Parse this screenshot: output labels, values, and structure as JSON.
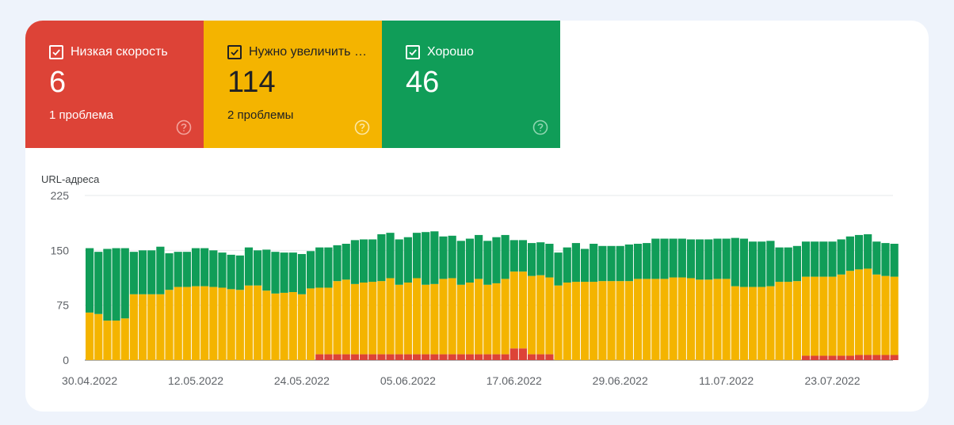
{
  "tiles": [
    {
      "title": "Низкая скорость",
      "value": "6",
      "sub": "1 проблема",
      "color": "#dd4337"
    },
    {
      "title": "Нужно увеличить скорость",
      "value": "114",
      "sub": "2 проблемы",
      "color": "#f4b400"
    },
    {
      "title": "Хорошо",
      "value": "46",
      "sub": "",
      "color": "#109d58"
    }
  ],
  "icons": {
    "checkbox": "checkbox-checked-icon",
    "help": "help-circle-icon"
  },
  "chart_data": {
    "type": "bar",
    "stacked": true,
    "ylabel": "URL-адреса",
    "ylim": [
      0,
      225
    ],
    "yticks": [
      0,
      75,
      150,
      225
    ],
    "grid": true,
    "xticks": [
      "30.04.2022",
      "12.05.2022",
      "24.05.2022",
      "05.06.2022",
      "17.06.2022",
      "29.06.2022",
      "11.07.2022",
      "23.07.2022"
    ],
    "x_start": "30.04.2022",
    "x_end": "29.07.2022",
    "series": [
      {
        "color": "#dd4337",
        "values": [
          0,
          0,
          0,
          0,
          0,
          0,
          0,
          0,
          0,
          0,
          0,
          0,
          0,
          0,
          0,
          0,
          0,
          0,
          0,
          0,
          0,
          0,
          0,
          0,
          0,
          0,
          8,
          8,
          8,
          8,
          8,
          8,
          8,
          8,
          8,
          8,
          8,
          8,
          8,
          8,
          8,
          8,
          8,
          8,
          8,
          8,
          8,
          8,
          16,
          16,
          8,
          8,
          8,
          0,
          0,
          0,
          0,
          0,
          0,
          0,
          0,
          0,
          0,
          0,
          0,
          0,
          0,
          0,
          0,
          0,
          0,
          0,
          0,
          0,
          0,
          0,
          0,
          0,
          0,
          0,
          0,
          6,
          6,
          6,
          6,
          6,
          6,
          7,
          7,
          7,
          7,
          7
        ]
      },
      {
        "color": "#f4b400",
        "values": [
          65,
          63,
          54,
          54,
          57,
          90,
          90,
          90,
          90,
          96,
          100,
          100,
          101,
          101,
          100,
          99,
          97,
          96,
          102,
          102,
          95,
          91,
          92,
          93,
          90,
          98,
          91,
          91,
          100,
          102,
          96,
          98,
          99,
          100,
          104,
          95,
          98,
          104,
          95,
          96,
          103,
          104,
          95,
          98,
          103,
          95,
          97,
          103,
          105,
          105,
          107,
          108,
          105,
          102,
          106,
          107,
          107,
          107,
          108,
          108,
          108,
          108,
          111,
          111,
          111,
          111,
          113,
          113,
          112,
          110,
          110,
          111,
          111,
          101,
          100,
          100,
          100,
          101,
          107,
          107,
          108,
          108,
          108,
          108,
          108,
          111,
          116,
          117,
          118,
          110,
          108,
          107,
          114,
          113
        ]
      },
      {
        "color": "#109d58",
        "values": [
          88,
          85,
          98,
          99,
          96,
          58,
          60,
          60,
          65,
          50,
          48,
          48,
          52,
          52,
          50,
          48,
          47,
          47,
          52,
          48,
          56,
          57,
          55,
          54,
          55,
          51,
          55,
          55,
          49,
          49,
          60,
          59,
          58,
          64,
          62,
          62,
          62,
          62,
          72,
          72,
          58,
          58,
          60,
          60,
          60,
          60,
          63,
          60,
          43,
          43,
          45,
          45,
          46,
          45,
          48,
          53,
          45,
          52,
          48,
          48,
          48,
          50,
          48,
          49,
          55,
          55,
          53,
          53,
          53,
          55,
          55,
          55,
          55,
          66,
          66,
          62,
          62,
          62,
          47,
          47,
          48,
          48,
          48,
          48,
          48,
          48,
          47,
          47,
          47,
          45,
          45,
          45,
          45,
          46
        ]
      }
    ]
  }
}
